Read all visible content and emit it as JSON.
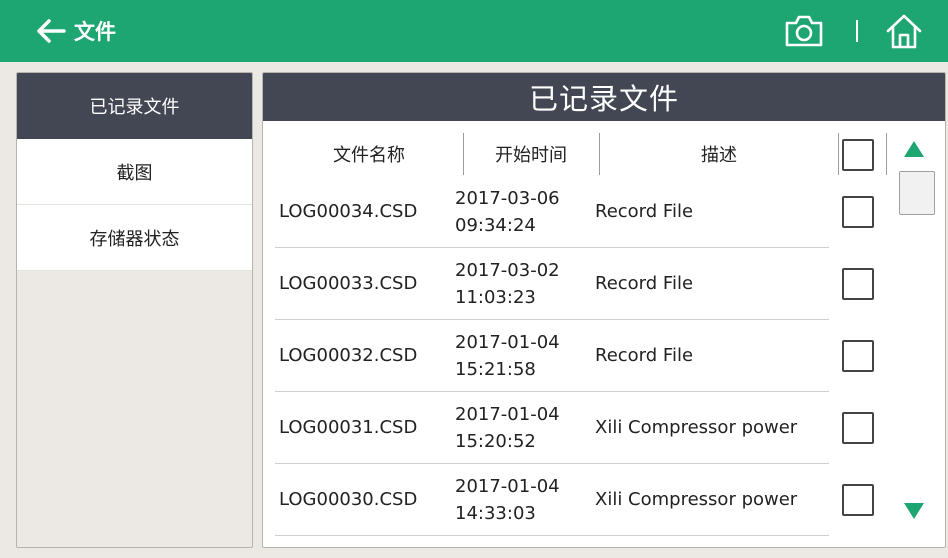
{
  "topbar": {
    "back_label": "文件",
    "accent_color": "#1ea672"
  },
  "sidebar": {
    "items": [
      {
        "label": "已记录文件",
        "active": true
      },
      {
        "label": "截图",
        "active": false
      },
      {
        "label": "存储器状态",
        "active": false
      }
    ]
  },
  "panel": {
    "title": "已记录文件",
    "headers": {
      "name": "文件名称",
      "time": "开始时间",
      "desc": "描述"
    },
    "rows": [
      {
        "name": "LOG00034.CSD",
        "date": "2017-03-06",
        "time": "09:34:24",
        "desc": "Record File",
        "checked": false
      },
      {
        "name": "LOG00033.CSD",
        "date": "2017-03-02",
        "time": "11:03:23",
        "desc": "Record File",
        "checked": false
      },
      {
        "name": "LOG00032.CSD",
        "date": "2017-01-04",
        "time": "15:21:58",
        "desc": "Record File",
        "checked": false
      },
      {
        "name": "LOG00031.CSD",
        "date": "2017-01-04",
        "time": "15:20:52",
        "desc": "Xili Compressor power",
        "checked": false
      },
      {
        "name": "LOG00030.CSD",
        "date": "2017-01-04",
        "time": "14:33:03",
        "desc": "Xili Compressor power",
        "checked": false
      }
    ]
  },
  "icons": {
    "back": "arrow-left-icon",
    "camera": "camera-icon",
    "home": "home-icon",
    "scroll_up": "triangle-up-icon",
    "scroll_down": "triangle-down-icon"
  }
}
